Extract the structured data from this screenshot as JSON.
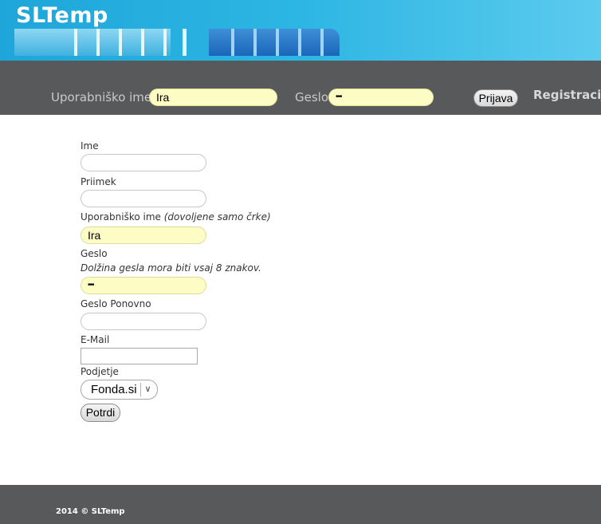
{
  "header": {
    "app_title": "SLTemp"
  },
  "login_bar": {
    "username_label": "Uporabniško ime",
    "username_value": "Ira",
    "password_label": "Geslo",
    "password_value": "•••",
    "login_button": "Prijava",
    "register_link": "Registracija"
  },
  "form": {
    "first_name_label": "Ime",
    "last_name_label": "Priimek",
    "username_label": "Uporabniško ime",
    "username_hint": "(dovoljene samo črke)",
    "username_value": "Ira",
    "password_label": "Geslo",
    "password_note": "Dolžina gesla mora biti vsaj 8 znakov.",
    "password_value": "•••",
    "password_repeat_label": "Geslo Ponovno",
    "email_label": "E-Mail",
    "company_label": "Podjetje",
    "company_selected": "Fonda.si",
    "submit_button": "Potrdi"
  },
  "footer": {
    "copyright": "2014 © SLTemp"
  },
  "colors": {
    "header_blue": "#2db6e3",
    "bar_gray": "#58595b",
    "input_fill_yellow": "#fcfcc4"
  },
  "icons": {
    "select_arrow": "chevron-down-icon"
  }
}
